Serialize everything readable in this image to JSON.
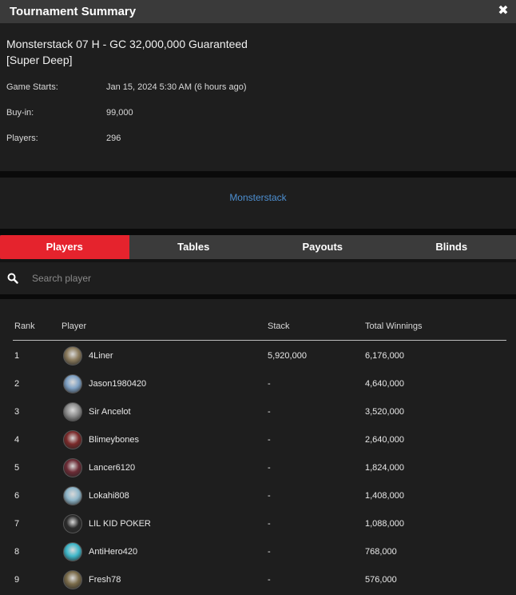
{
  "window": {
    "title": "Tournament Summary",
    "close_icon": "close-icon"
  },
  "tournament": {
    "name": "Monsterstack 07 H - GC 32,000,000 Guaranteed [Super Deep]",
    "details": [
      {
        "label": "Game Starts:",
        "value": "Jan 15, 2024 5:30 AM (6 hours ago)"
      },
      {
        "label": "Buy-in:",
        "value": "99,000"
      },
      {
        "label": "Players:",
        "value": "296"
      }
    ],
    "series_link": "Monsterstack"
  },
  "tabs": [
    {
      "label": "Players",
      "active": true
    },
    {
      "label": "Tables",
      "active": false
    },
    {
      "label": "Payouts",
      "active": false
    },
    {
      "label": "Blinds",
      "active": false
    }
  ],
  "search": {
    "placeholder": "Search player",
    "value": "",
    "icon": "search-icon"
  },
  "table": {
    "headers": {
      "rank": "Rank",
      "player": "Player",
      "stack": "Stack",
      "winnings": "Total Winnings"
    },
    "rows": [
      {
        "rank": "1",
        "player": "4Liner",
        "stack": "5,920,000",
        "winnings": "6,176,000",
        "avatar_color": "#8a7a5c"
      },
      {
        "rank": "2",
        "player": "Jason1980420",
        "stack": "-",
        "winnings": "4,640,000",
        "avatar_color": "#7fa1c4"
      },
      {
        "rank": "3",
        "player": "Sir Ancelot",
        "stack": "-",
        "winnings": "3,520,000",
        "avatar_color": "#8e8e8e"
      },
      {
        "rank": "4",
        "player": "Blimeybones",
        "stack": "-",
        "winnings": "2,640,000",
        "avatar_color": "#7a2a2a"
      },
      {
        "rank": "5",
        "player": "Lancer6120",
        "stack": "-",
        "winnings": "1,824,000",
        "avatar_color": "#6b2b35"
      },
      {
        "rank": "6",
        "player": "Lokahi808",
        "stack": "-",
        "winnings": "1,408,000",
        "avatar_color": "#8fb6c9"
      },
      {
        "rank": "7",
        "player": "LIL KID POKER",
        "stack": "-",
        "winnings": "1,088,000",
        "avatar_color": "#2b2b2b"
      },
      {
        "rank": "8",
        "player": "AntiHero420",
        "stack": "-",
        "winnings": "768,000",
        "avatar_color": "#3fb7c9"
      },
      {
        "rank": "9",
        "player": "Fresh78",
        "stack": "-",
        "winnings": "576,000",
        "avatar_color": "#7a6b4a"
      }
    ]
  },
  "colors": {
    "accent": "#e5232d",
    "link": "#4d8fd1",
    "background": "#1e1e1e"
  }
}
